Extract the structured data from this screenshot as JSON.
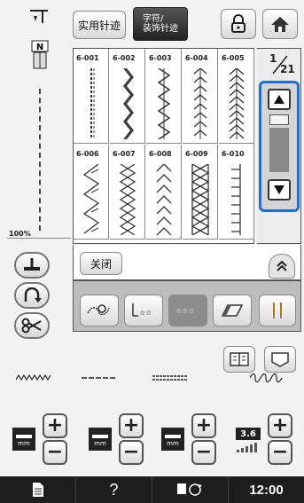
{
  "top_bar": {
    "utility_stitch_label": "实用针迹",
    "char_deco_label": "字符/\n装饰针迹"
  },
  "left_panel": {
    "zoom": "100%"
  },
  "grid": {
    "page_current": "1",
    "page_total": "21",
    "stitches": [
      {
        "code": "6-001"
      },
      {
        "code": "6-002"
      },
      {
        "code": "6-003"
      },
      {
        "code": "6-004"
      },
      {
        "code": "6-005"
      },
      {
        "code": "6-006"
      },
      {
        "code": "6-007"
      },
      {
        "code": "6-008"
      },
      {
        "code": "6-009"
      },
      {
        "code": "6-010"
      }
    ]
  },
  "close_label": "关闭",
  "status_bar": {
    "time": "12:00",
    "help": "?"
  },
  "controls": {
    "density_value": "3.6"
  },
  "colors": {
    "accent_blue": "#1e6fd0",
    "dark": "#1e1e1e"
  },
  "icons": [
    "needle-icon",
    "presser-foot-icon",
    "lock-icon",
    "home-icon",
    "scissors-icon",
    "thread-cut-icon",
    "reverse-icon",
    "mirror-icon",
    "eraser-icon",
    "twin-needle-icon",
    "book-icon",
    "pocket-icon",
    "document-icon",
    "speed-icon"
  ]
}
